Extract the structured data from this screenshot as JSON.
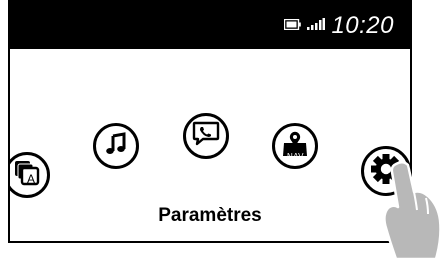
{
  "status_bar": {
    "time": "10:20",
    "icons": [
      "battery-icon",
      "signal-bars-icon"
    ]
  },
  "menu": {
    "items": [
      {
        "id": "apps",
        "icon": "apps-icon",
        "glyph_text": "A"
      },
      {
        "id": "music",
        "icon": "music-note-icon"
      },
      {
        "id": "phone",
        "icon": "phone-bubble-icon"
      },
      {
        "id": "navigation",
        "icon": "nav-map-icon",
        "glyph_text": "NAV"
      },
      {
        "id": "settings",
        "icon": "gear-icon",
        "selected": true
      }
    ],
    "selected_label": "Paramètres"
  },
  "colors": {
    "statusbar_bg": "#000000",
    "icon_stroke": "#000000",
    "hand_fill": "#b8b8b8"
  }
}
